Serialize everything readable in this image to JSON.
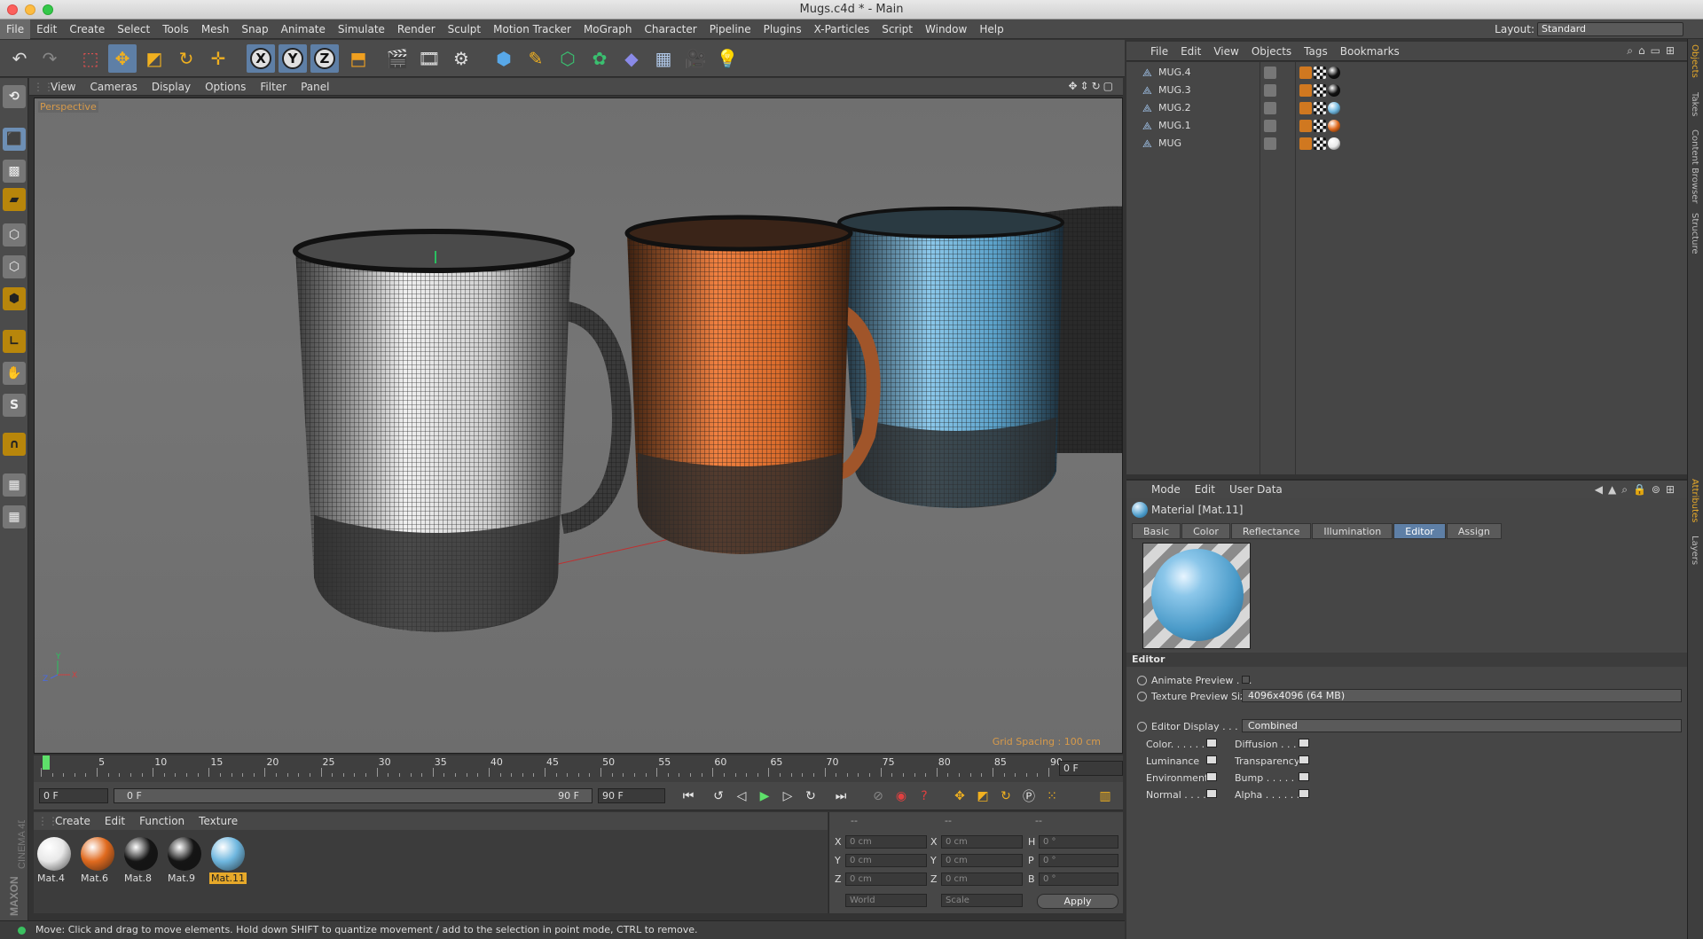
{
  "window": {
    "title": "Mugs.c4d * - Main"
  },
  "menubar": {
    "items": [
      "File",
      "Edit",
      "Create",
      "Select",
      "Tools",
      "Mesh",
      "Snap",
      "Animate",
      "Simulate",
      "Render",
      "Sculpt",
      "Motion Tracker",
      "MoGraph",
      "Character",
      "Pipeline",
      "Plugins",
      "X-Particles",
      "Script",
      "Window",
      "Help"
    ],
    "layout_label": "Layout:",
    "layout_value": "Standard"
  },
  "toolbar": {
    "icons": [
      "undo-icon",
      "redo-icon",
      "live-selection-icon",
      "move-icon",
      "scale-icon",
      "rotate-icon",
      "recent-tools-icon",
      "x-axis-icon",
      "y-axis-icon",
      "z-axis-icon",
      "world-coordinate-icon",
      "render-view-icon",
      "render-picture-viewer-icon",
      "edit-render-settings-icon",
      "cube-icon",
      "pen-spline-icon",
      "subdivision-surface-icon",
      "array-icon",
      "deformer-icon",
      "floor-icon",
      "camera-icon",
      "light-icon"
    ]
  },
  "viewport": {
    "menu": [
      "View",
      "Cameras",
      "Display",
      "Options",
      "Filter",
      "Panel"
    ],
    "label": "Perspective",
    "grid_spacing": "Grid Spacing : 100 cm"
  },
  "timeline": {
    "ticks": [
      "0",
      "5",
      "10",
      "15",
      "20",
      "25",
      "30",
      "35",
      "40",
      "45",
      "50",
      "55",
      "60",
      "65",
      "70",
      "75",
      "80",
      "85",
      "90"
    ],
    "current_frame": "0 F",
    "start": "0 F",
    "range_start": "0 F",
    "range_end": "90 F",
    "end": "90 F"
  },
  "material_manager": {
    "menu": [
      "Create",
      "Edit",
      "Function",
      "Texture"
    ],
    "materials": [
      {
        "name": "Mat.4",
        "color": "#e8e8e8",
        "selected": false
      },
      {
        "name": "Mat.6",
        "color": "#e06a1e",
        "selected": false
      },
      {
        "name": "Mat.8",
        "color": "#151515",
        "selected": false
      },
      {
        "name": "Mat.9",
        "color": "#151515",
        "selected": false
      },
      {
        "name": "Mat.11",
        "color": "#6fb7df",
        "selected": true
      }
    ]
  },
  "coordinates": {
    "header": [
      "--",
      "--",
      "--"
    ],
    "rows": [
      {
        "a": "X",
        "av": "0 cm",
        "b": "X",
        "bv": "0 cm",
        "c": "H",
        "cv": "0 °"
      },
      {
        "a": "Y",
        "av": "0 cm",
        "b": "Y",
        "bv": "0 cm",
        "c": "P",
        "cv": "0 °"
      },
      {
        "a": "Z",
        "av": "0 cm",
        "b": "Z",
        "bv": "0 cm",
        "c": "B",
        "cv": "0 °"
      }
    ],
    "space": "World",
    "mode": "Scale",
    "apply": "Apply"
  },
  "status": "Move: Click and drag to move elements. Hold down SHIFT to quantize movement / add to the selection in point mode, CTRL to remove.",
  "object_manager": {
    "menu": [
      "File",
      "Edit",
      "View",
      "Objects",
      "Tags",
      "Bookmarks"
    ],
    "objects": [
      {
        "name": "MUG.4",
        "mat": "#111111"
      },
      {
        "name": "MUG.3",
        "mat": "#111111"
      },
      {
        "name": "MUG.2",
        "mat": "#6fb7df"
      },
      {
        "name": "MUG.1",
        "mat": "#e06a1e"
      },
      {
        "name": "MUG",
        "mat": "#e8e8e8"
      }
    ]
  },
  "attribute_manager": {
    "menu": [
      "Mode",
      "Edit",
      "User Data"
    ],
    "title": "Material [Mat.11]",
    "tabs": [
      "Basic",
      "Color",
      "Reflectance",
      "Illumination",
      "Editor",
      "Assign"
    ],
    "active_tab": "Editor",
    "section": "Editor",
    "animate_preview": "Animate Preview . . .",
    "texture_preview_size_label": "Texture Preview Size",
    "texture_preview_size": "4096x4096 (64 MB)",
    "editor_display_label": "Editor Display . . . . .",
    "editor_display": "Combined",
    "channels_left": [
      "Color. . . . . .",
      "Luminance",
      "Environment",
      "Normal . . . ."
    ],
    "channels_right": [
      "Diffusion . . .",
      "Transparency",
      "Bump . . . . .",
      "Alpha . . . . . ."
    ]
  },
  "right_tabs": [
    "Objects",
    "Takes",
    "Content Browser",
    "Structure",
    "Attributes",
    "Layers"
  ],
  "brand": "MAXON CINEMA 4D"
}
